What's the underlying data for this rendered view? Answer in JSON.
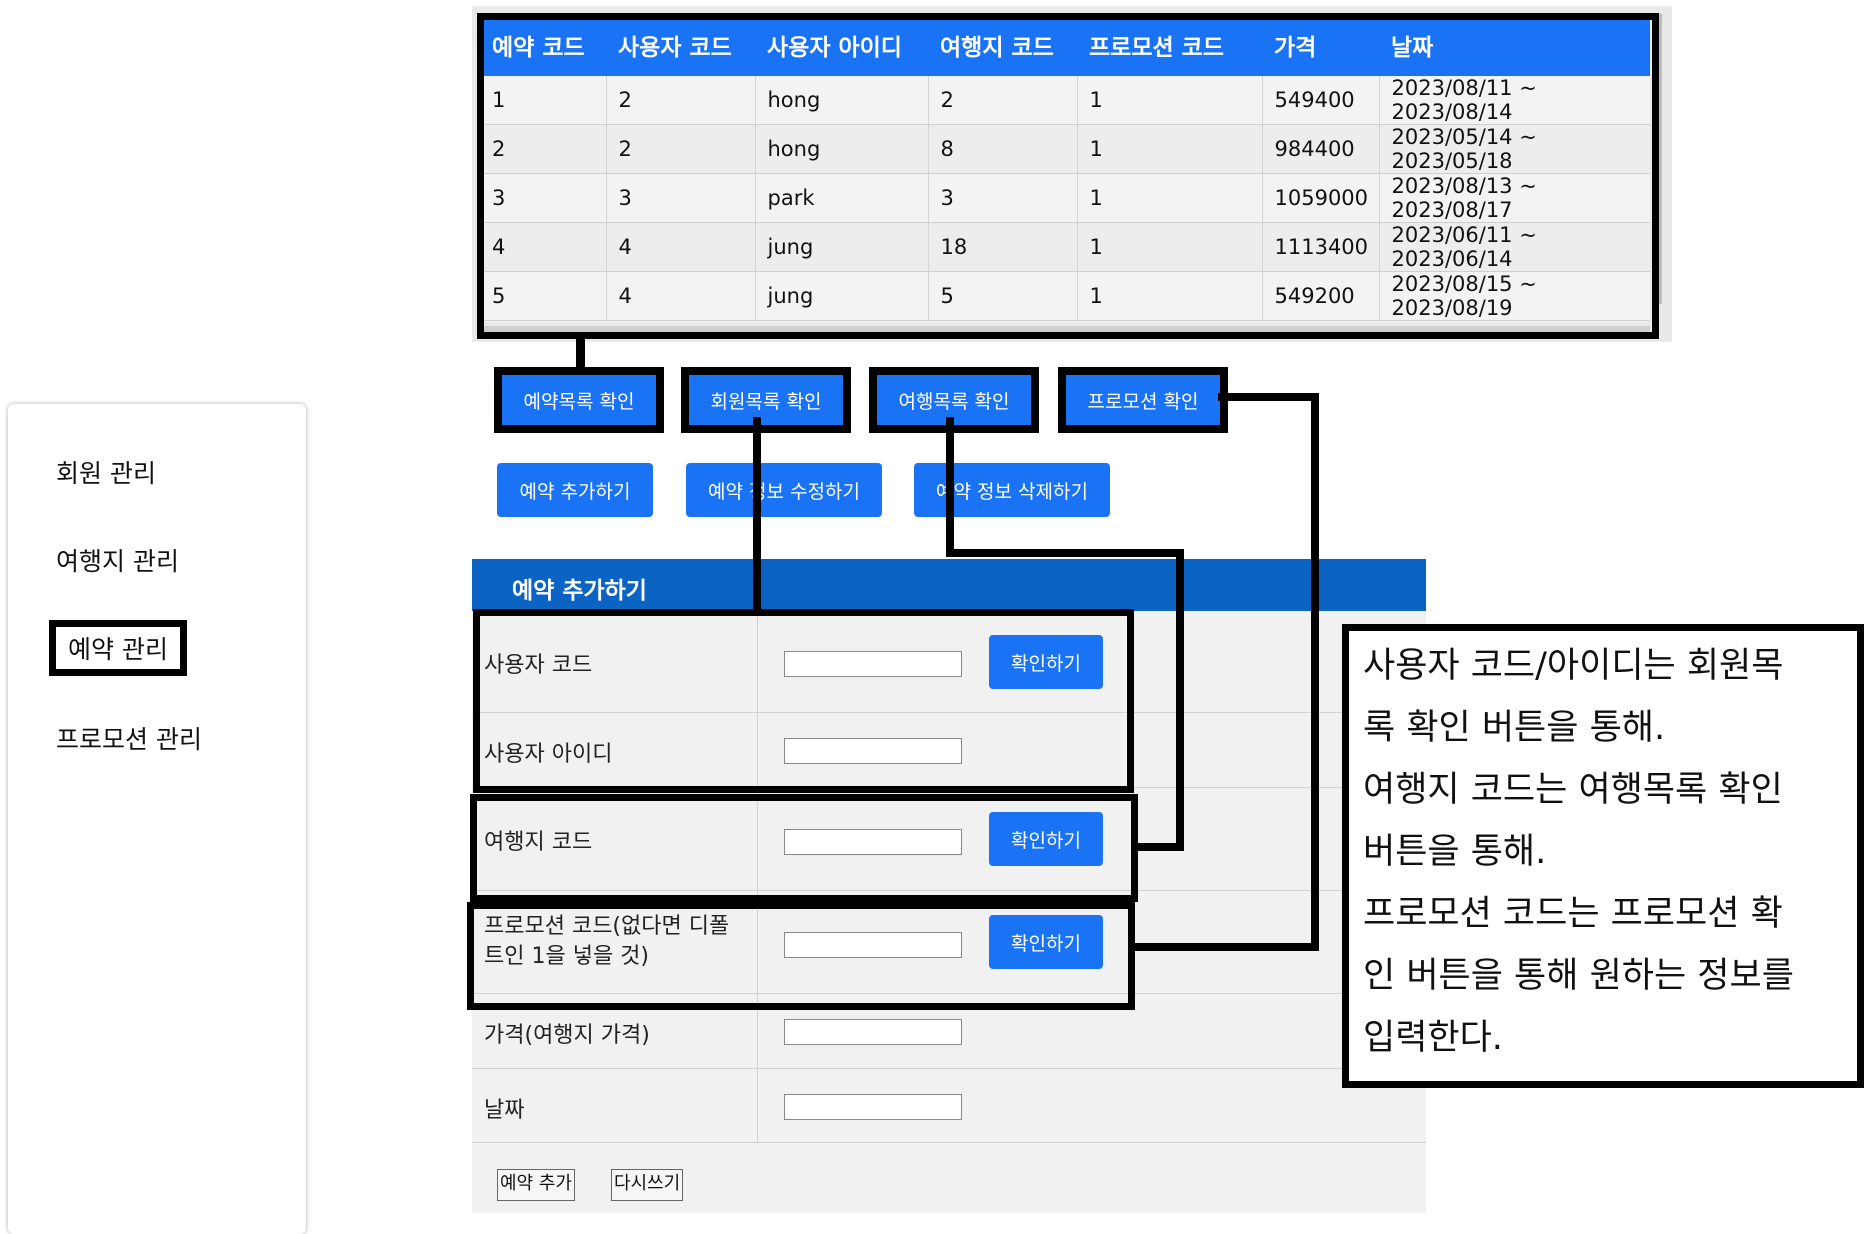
{
  "sidebar": {
    "items": [
      {
        "label": "회원 관리",
        "active": false
      },
      {
        "label": "여행지 관리",
        "active": false
      },
      {
        "label": "예약 관리",
        "active": true
      },
      {
        "label": "프로모션 관리",
        "active": false
      }
    ]
  },
  "table": {
    "headers": [
      "예약 코드",
      "사용자 코드",
      "사용자 아이디",
      "여행지 코드",
      "프로모션 코드",
      "가격",
      "날짜"
    ],
    "rows": [
      [
        "1",
        "2",
        "hong",
        "2",
        "1",
        "549400",
        "2023/08/11 ~ 2023/08/14"
      ],
      [
        "2",
        "2",
        "hong",
        "8",
        "1",
        "984400",
        "2023/05/14 ~ 2023/05/18"
      ],
      [
        "3",
        "3",
        "park",
        "3",
        "1",
        "1059000",
        "2023/08/13 ~ 2023/08/17"
      ],
      [
        "4",
        "4",
        "jung",
        "18",
        "1",
        "1113400",
        "2023/06/11 ~ 2023/06/14"
      ],
      [
        "5",
        "4",
        "jung",
        "5",
        "1",
        "549200",
        "2023/08/15 ~ 2023/08/19"
      ]
    ]
  },
  "list_buttons": {
    "reservation_list": "예약목록 확인",
    "member_list": "회원목록 확인",
    "travel_list": "여행목록 확인",
    "promotion_list": "프로모션 확인"
  },
  "action_buttons": {
    "add": "예약 추가하기",
    "edit": "예약 정보 수정하기",
    "delete": "예약 정보 삭제하기"
  },
  "form": {
    "title": "예약 추가하기",
    "fields": {
      "user_code": "사용자 코드",
      "user_id": "사용자 아이디",
      "travel_code": "여행지 코드",
      "promotion_code_line1": "프로모션 코드(없다면 디폴",
      "promotion_code_line2": "트인 1을 넣을 것)",
      "price": "가격(여행지 가격)",
      "date": "날짜"
    },
    "confirm_label": "확인하기",
    "submit_label": "예약 추가",
    "reset_label": "다시쓰기"
  },
  "annotation": {
    "lines": [
      "사용자 코드/아이디는 회원목",
      "록 확인 버튼을 통해.",
      "여행지 코드는 여행목록 확인",
      "버튼을 통해.",
      "프로모션 코드는 프로모션 확",
      "인 버튼을 통해 원하는 정보를",
      "입력한다."
    ]
  },
  "colors": {
    "accent": "#1a73f5",
    "form_header": "#0b63c4"
  }
}
